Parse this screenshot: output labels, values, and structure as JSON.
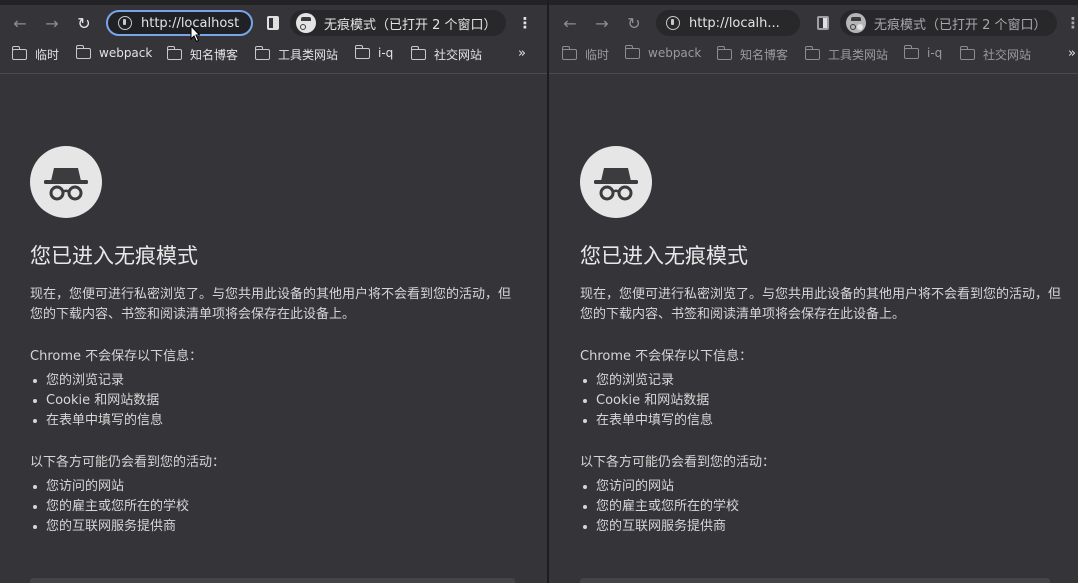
{
  "panes": [
    {
      "url": "http://localhost",
      "incognito_label": "无痕模式（已打开 2 个窗口）",
      "bookmarks": [
        {
          "label": "临时"
        },
        {
          "label": "webpack"
        },
        {
          "label": "知名博客"
        },
        {
          "label": "工具类网站"
        },
        {
          "label": "i-q"
        },
        {
          "label": "社交网站"
        }
      ],
      "bookmarks_more": "»"
    },
    {
      "url": "http://localh...",
      "incognito_label": "无痕模式（已打开 2 个窗口）",
      "bookmarks": [
        {
          "label": "临时"
        },
        {
          "label": "webpack"
        },
        {
          "label": "知名博客"
        },
        {
          "label": "工具类网站"
        },
        {
          "label": "i-q"
        },
        {
          "label": "社交网站"
        }
      ],
      "bookmarks_more": "»"
    }
  ],
  "nav": {
    "back_icon": "←",
    "forward_icon": "→",
    "reload_icon": "↻",
    "menu_icon": "⋮"
  },
  "page": {
    "heading": "您已进入无痕模式",
    "intro": "现在，您便可进行私密浏览了。与您共用此设备的其他用户将不会看到您的活动，但您的下载内容、书签和阅读清单项将会保存在此设备上。",
    "not_saved_title": "Chrome 不会保存以下信息：",
    "not_saved_items": [
      "您的浏览记录",
      "Cookie 和网站数据",
      "在表单中填写的信息"
    ],
    "visible_title": "以下各方可能仍会看到您的活动：",
    "visible_items": [
      "您访问的网站",
      "您的雇主或您所在的学校",
      "您的互联网服务提供商"
    ]
  }
}
